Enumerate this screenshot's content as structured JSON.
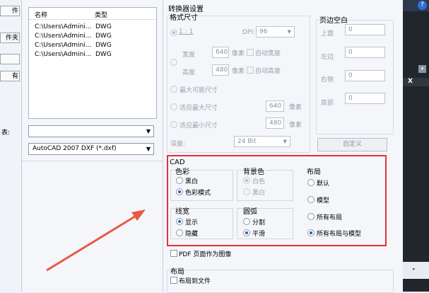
{
  "left": {
    "edge_buttons": [
      "件",
      "件夹",
      "",
      "有"
    ],
    "edge_label": "表:",
    "file_list": {
      "headers": [
        "名称",
        "类型"
      ],
      "rows": [
        [
          "C:\\Users\\Admini...",
          "DWG"
        ],
        [
          "C:\\Users\\Admini...",
          "DWG"
        ],
        [
          "C:\\Users\\Admini...",
          "DWG"
        ],
        [
          "C:\\Users\\Admini...",
          "DWG"
        ]
      ]
    },
    "format_combo": "AutoCAD 2007 DXF (*.dxf)"
  },
  "converter": {
    "title": "转换器设置",
    "format_size": {
      "title": "格式尺寸",
      "one_to_one": "1 : 1",
      "dpi_label": "DPI:",
      "dpi_value": "96",
      "width_label": "宽度",
      "width_value": "640",
      "height_label": "高度",
      "height_value": "480",
      "px": "像素",
      "auto_width": "自动宽度",
      "auto_height": "自动高度",
      "max_size": "最大可能尺寸",
      "fit_max": "适应最大尺寸",
      "fit_min": "适应最小尺寸",
      "fit_value_1": "640",
      "fit_value_2": "480",
      "depth_label": "深度:",
      "depth_value": "24 Bit"
    },
    "margins": {
      "title": "页边空白",
      "top": "上面",
      "left": "左边",
      "right": "右侧",
      "bottom": "底部",
      "values": [
        "0",
        "0",
        "0",
        "0"
      ],
      "custom_button": "自定义"
    },
    "cad": {
      "title": "CAD",
      "color": {
        "title": "色彩",
        "opt1": "黑白",
        "opt2": "色彩模式"
      },
      "background": {
        "title": "背景色",
        "opt1": "白色",
        "opt2": "黑白"
      },
      "layout": {
        "title": "布局",
        "opt1": "默认",
        "opt2": "模型",
        "opt3": "所有布局",
        "opt4": "所有布局与模型"
      },
      "lineweight": {
        "title": "线宽",
        "opt1": "显示",
        "opt2": "隐藏"
      },
      "arc": {
        "title": "圆弧",
        "opt1": "分割",
        "opt2": "平滑"
      }
    },
    "pdf_as_image": "PDF 页面作为图像",
    "layout_section": {
      "title": "布局",
      "layout_to_file": "布局到文件"
    }
  },
  "side": {
    "x_label": "X"
  },
  "colors": {
    "highlight": "#e0313a",
    "arrow": "#e85a44"
  }
}
